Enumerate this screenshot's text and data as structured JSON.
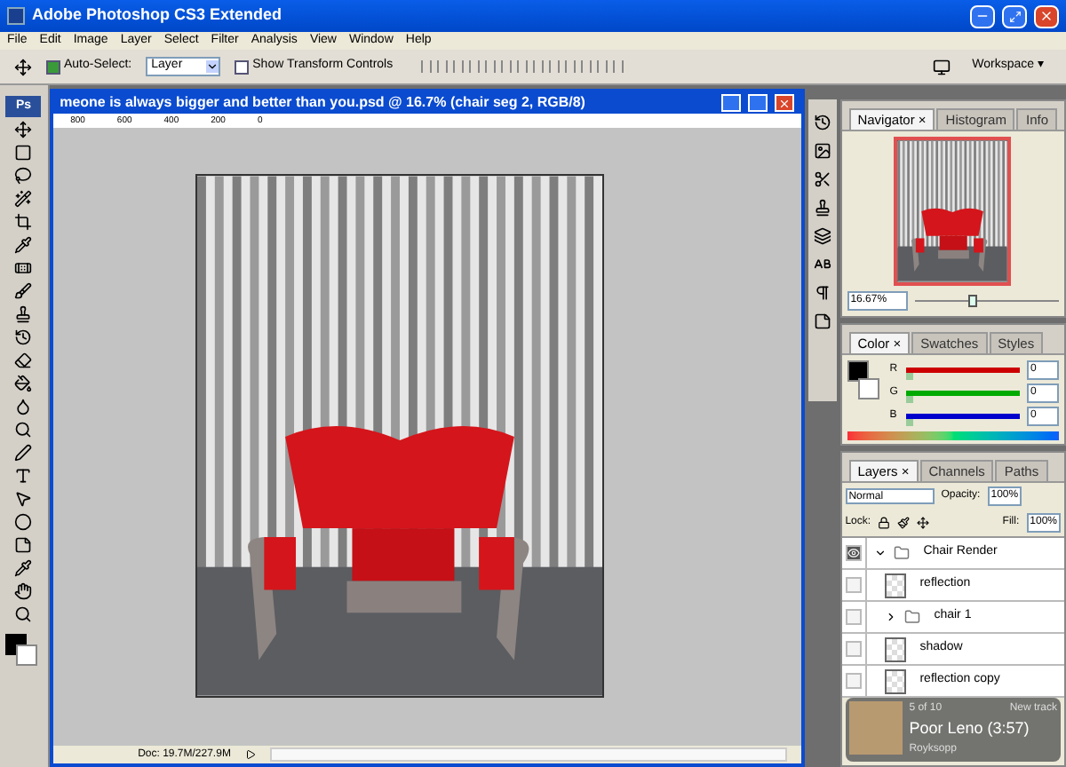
{
  "window": {
    "title": "Adobe Photoshop CS3 Extended"
  },
  "menu": [
    "File",
    "Edit",
    "Image",
    "Layer",
    "Select",
    "Filter",
    "Analysis",
    "View",
    "Window",
    "Help"
  ],
  "options": {
    "auto_select": {
      "label": "Auto-Select:",
      "checked": true,
      "value": "Layer"
    },
    "transform": {
      "label": "Show Transform Controls",
      "checked": false
    },
    "workspace": "Workspace",
    "workspace_caret": "▾"
  },
  "panel_close_mark": "×",
  "document": {
    "title": "meone is always bigger and better than you.psd @ 16.7% (chair seg 2, RGB/8)",
    "ruler": [
      "800",
      "600",
      "400",
      "200",
      "0"
    ],
    "status": "Doc: 19.7M/227.9M"
  },
  "toolbox": {
    "logo": "Ps"
  },
  "navigator": {
    "tabs": [
      {
        "label": "Navigator",
        "selected": true
      },
      {
        "label": "Histogram",
        "selected": false
      },
      {
        "label": "Info",
        "selected": false
      }
    ],
    "zoom": "16.67%",
    "level": 0.4
  },
  "color": {
    "tabs": [
      {
        "label": "Color",
        "selected": true
      },
      {
        "label": "Swatches",
        "selected": false
      },
      {
        "label": "Styles",
        "selected": false
      }
    ],
    "channels": [
      {
        "name": "R",
        "value": "0",
        "level": 0,
        "color": "#cc0000"
      },
      {
        "name": "G",
        "value": "0",
        "level": 0,
        "color": "#00aa00"
      },
      {
        "name": "B",
        "value": "0",
        "level": 0,
        "color": "#0000cc"
      }
    ]
  },
  "layers": {
    "tabs": [
      {
        "label": "Layers",
        "selected": true
      },
      {
        "label": "Channels",
        "selected": false
      },
      {
        "label": "Paths",
        "selected": false
      }
    ],
    "blend": "Normal",
    "opacity_label": "Opacity:",
    "opacity": "100%",
    "lock_label": "Lock:",
    "fill_label": "Fill:",
    "fill": "100%",
    "items": [
      {
        "kind": "group",
        "name": "Chair Render",
        "visible": true,
        "expanded": true,
        "children": [
          {
            "kind": "layer",
            "name": "reflection",
            "visible": false
          },
          {
            "kind": "group",
            "name": "chair 1",
            "visible": false,
            "expanded": false
          },
          {
            "kind": "layer",
            "name": "shadow",
            "visible": false
          },
          {
            "kind": "layer",
            "name": "reflection copy",
            "visible": false
          }
        ]
      }
    ]
  },
  "notification": {
    "position": "5 of 10",
    "label": "New track",
    "title": "Poor Leno (3:57)",
    "artist": "Royksopp"
  }
}
